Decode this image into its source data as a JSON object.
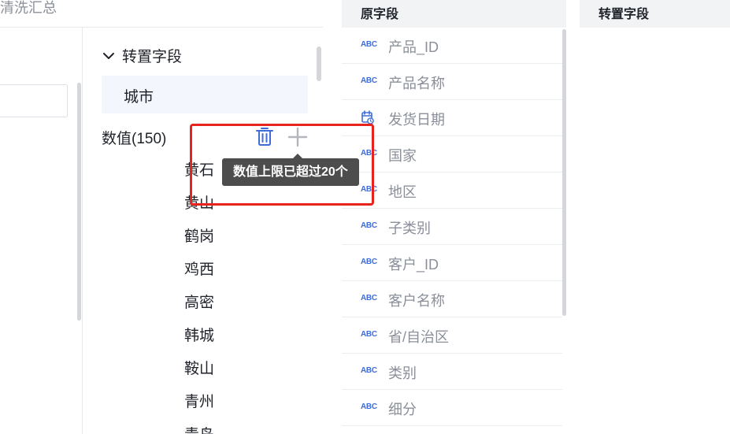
{
  "left": {
    "title": "清洗汇总"
  },
  "group": {
    "header_label": "转置字段",
    "selected_item": "城市",
    "value_label": "数值(150)",
    "tooltip": "数值上限已超过20个",
    "cities": [
      "黄石",
      "黄山",
      "鹤岗",
      "鸡西",
      "高密",
      "韩城",
      "鞍山",
      "青州",
      "青岛"
    ]
  },
  "original_fields": {
    "header": "原字段",
    "items": [
      {
        "type": "text",
        "type_label": "ABC",
        "name": "产品_ID"
      },
      {
        "type": "text",
        "type_label": "ABC",
        "name": "产品名称"
      },
      {
        "type": "date",
        "type_label": "",
        "name": "发货日期"
      },
      {
        "type": "text",
        "type_label": "ABC",
        "name": "国家"
      },
      {
        "type": "text",
        "type_label": "ABC",
        "name": "地区"
      },
      {
        "type": "text",
        "type_label": "ABC",
        "name": "子类别"
      },
      {
        "type": "text",
        "type_label": "ABC",
        "name": "客户_ID"
      },
      {
        "type": "text",
        "type_label": "ABC",
        "name": "客户名称"
      },
      {
        "type": "text",
        "type_label": "ABC",
        "name": "省/自治区"
      },
      {
        "type": "text",
        "type_label": "ABC",
        "name": "类别"
      },
      {
        "type": "text",
        "type_label": "ABC",
        "name": "细分"
      }
    ]
  },
  "transposed_fields": {
    "header": "转置字段"
  },
  "colors": {
    "accent_blue": "#3f6cd8",
    "highlight_red": "#e8231b",
    "tooltip_bg": "#4d4d4d",
    "selected_bg": "#f3f6fd"
  },
  "icons": {
    "chevron": "chevron-down-icon",
    "delete": "trash-icon",
    "add": "plus-icon",
    "date": "calendar-icon"
  }
}
